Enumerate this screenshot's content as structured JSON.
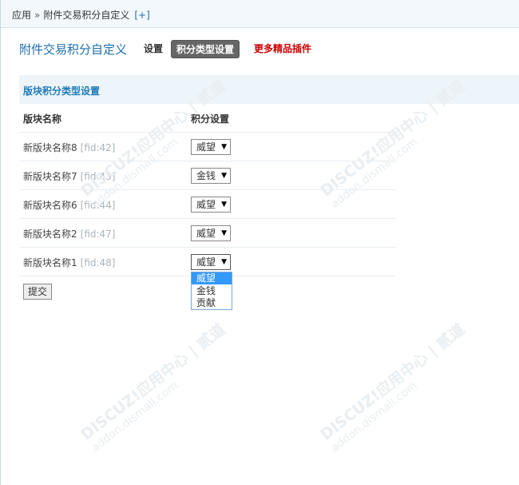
{
  "breadcrumb": {
    "root": "应用",
    "separator": "»",
    "current": "附件交易积分自定义",
    "add": "[+]"
  },
  "header": {
    "title": "附件交易积分自定义",
    "tabs": [
      {
        "label": "设置"
      },
      {
        "label": "积分类型设置",
        "active": true
      }
    ],
    "more_link": "更多精品插件"
  },
  "section": {
    "title": "版块积分类型设置"
  },
  "table": {
    "columns": [
      "版块名称",
      "积分设置"
    ],
    "rows": [
      {
        "name": "新版块名称8",
        "fid": "[fid:42]",
        "value": "威望"
      },
      {
        "name": "新版块名称7",
        "fid": "[fid:43]",
        "value": "金钱"
      },
      {
        "name": "新版块名称6",
        "fid": "[fid:44]",
        "value": "威望"
      },
      {
        "name": "新版块名称2",
        "fid": "[fid:47]",
        "value": "威望"
      },
      {
        "name": "新版块名称1",
        "fid": "[fid:48]",
        "value": "威望"
      }
    ]
  },
  "dropdown": {
    "options": [
      "威望",
      "金钱",
      "贡献"
    ],
    "highlighted": "威望"
  },
  "submit_label": "提交",
  "watermark": {
    "brand": "DISCUZ!应用中心 | 贰道",
    "url": "addon.dismall.com"
  },
  "colors": {
    "title": "#1c6eab",
    "section_title": "#1f7ab8",
    "more_link": "#cc0000",
    "active_tab_bg": "#666666",
    "highlight": "#3399ff"
  },
  "select_arrow": "▼"
}
